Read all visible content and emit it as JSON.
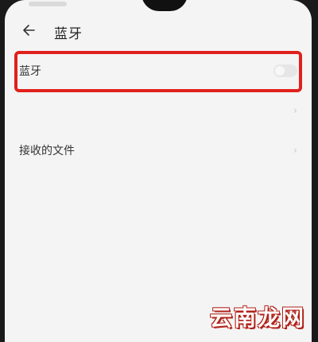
{
  "header": {
    "back_icon": "arrow-left-icon",
    "title": "蓝牙"
  },
  "settings": {
    "items": [
      {
        "label": "蓝牙",
        "control": "toggle",
        "state": "off"
      },
      {
        "label": "",
        "value": ""
      },
      {
        "label": "接收的文件",
        "value": ""
      }
    ]
  },
  "highlight": {
    "color": "#e0201c"
  },
  "watermark": {
    "text": "云南龙网"
  }
}
